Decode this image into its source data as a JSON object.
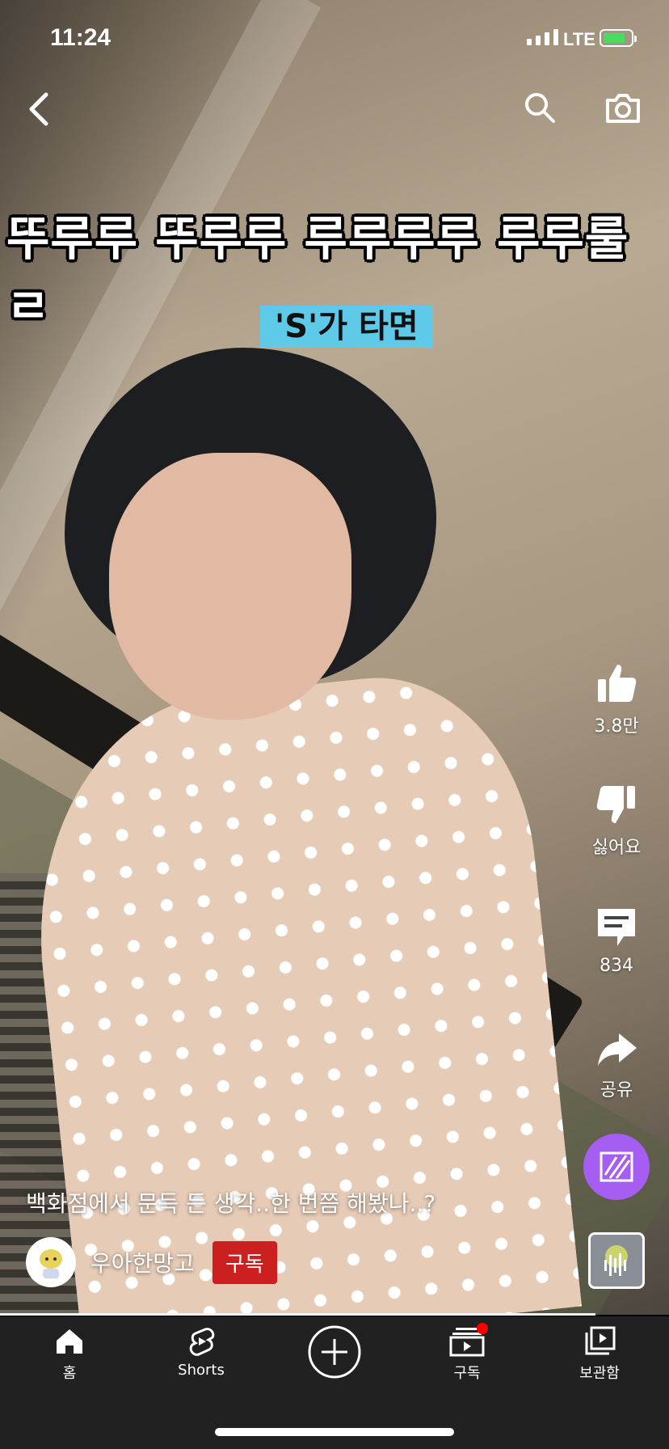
{
  "status_bar": {
    "time": "11:24",
    "network": "LTE"
  },
  "video": {
    "caption_top": "뚜루루 뚜루루 루루루루 루루룰ㄹ",
    "caption_tag": "'S'가 타면",
    "title": "백화점에서 문득 든 생각..한 번쯤 해봤나..?",
    "progress": 0.89
  },
  "channel": {
    "name": "우아한망고",
    "subscribe_label": "구독"
  },
  "actions": {
    "like_count": "3.8만",
    "dislike_label": "싫어요",
    "comment_count": "834",
    "share_label": "공유"
  },
  "nav": {
    "home": "홈",
    "shorts": "Shorts",
    "subscriptions": "구독",
    "library": "보관함"
  },
  "colors": {
    "subscribe": "#cc1f1f",
    "remix": "#a55df2",
    "nav_bg": "#212121",
    "notification_dot": "#ff0000",
    "battery": "#4cd964"
  }
}
